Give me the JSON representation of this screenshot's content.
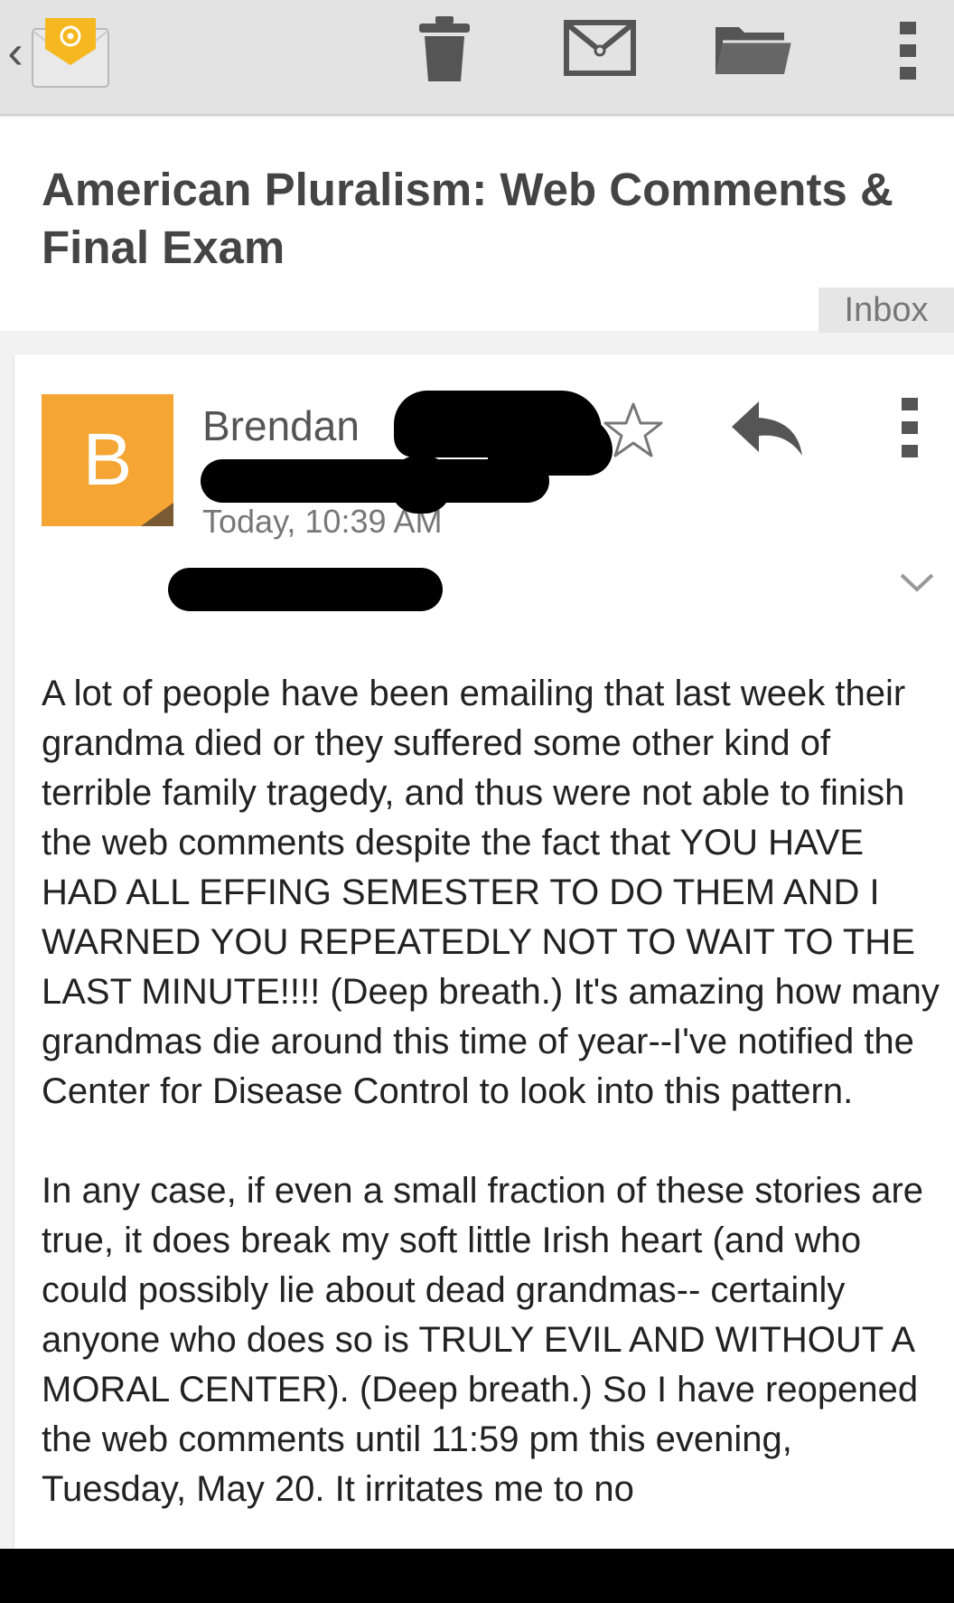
{
  "toolbar": {
    "back_glyph": "‹",
    "icons": [
      "app-email-icon",
      "trash-icon",
      "mail-icon",
      "folder-icon",
      "overflow-menu-icon"
    ]
  },
  "message": {
    "subject": "American Pluralism: Web Comments & Final Exam",
    "label": "Inbox",
    "avatar_letter": "B",
    "sender_name": "Brendan",
    "date": "Today, 10:39 AM",
    "body": [
      "A lot of people have been emailing that last week their grandma died or they suffered some other kind of terrible family tragedy, and thus were not able to finish the web comments despite the fact that YOU HAVE HAD ALL EFFING SEMESTER TO DO THEM AND I WARNED YOU REPEATEDLY NOT TO WAIT TO THE LAST MINUTE!!!! (Deep breath.) It's amazing how many grandmas die around this time of year--I've notified the Center for Disease Control to look into this pattern.",
      "In any case, if even a small fraction of these stories are true, it does break my soft little Irish heart (and who could possibly lie about dead grandmas-- certainly anyone who does so is TRULY EVIL AND WITHOUT A MORAL CENTER). (Deep breath.) So I have reopened the web comments until 11:59 pm this evening, Tuesday, May 20. It irritates me to no"
    ]
  },
  "colors": {
    "toolbar_bg": "#e3e3e3",
    "avatar_bg": "#f4a533",
    "icon_gray": "#555555"
  }
}
